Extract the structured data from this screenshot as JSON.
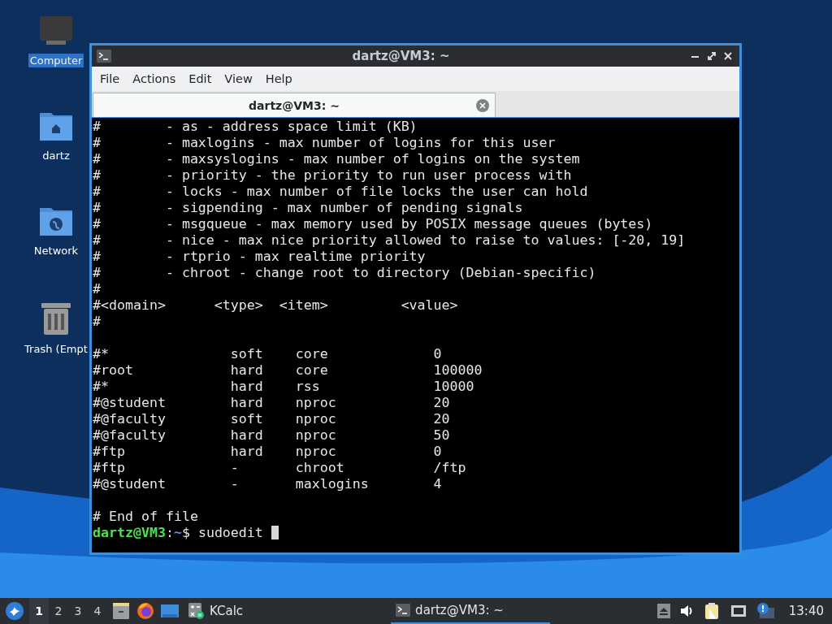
{
  "desktop_icons": [
    {
      "kind": "computer",
      "label": "Computer",
      "selected": true
    },
    {
      "kind": "home",
      "label": "dartz",
      "selected": false
    },
    {
      "kind": "network",
      "label": "Network",
      "selected": false
    },
    {
      "kind": "trash",
      "label": "Trash (Empt",
      "selected": false
    }
  ],
  "window": {
    "title": "dartz@VM3: ~",
    "menu": [
      "File",
      "Actions",
      "Edit",
      "View",
      "Help"
    ],
    "tabs": [
      {
        "label": "dartz@VM3: ~",
        "selected": true
      }
    ],
    "terminal": {
      "blocks": [
        [
          "#        - as - address space limit (KB)",
          "#        - maxlogins - max number of logins for this user",
          "#        - maxsyslogins - max number of logins on the system",
          "#        - priority - the priority to run user process with",
          "#        - locks - max number of file locks the user can hold",
          "#        - sigpending - max number of pending signals",
          "#        - msgqueue - max memory used by POSIX message queues (bytes)",
          "#        - nice - max nice priority allowed to raise to values: [-20, 19]",
          "#        - rtprio - max realtime priority",
          "#        - chroot - change root to directory (Debian-specific)",
          "#",
          "#<domain>      <type>  <item>         <value>",
          "#"
        ],
        [
          "#*               soft    core             0",
          "#root            hard    core             100000",
          "#*               hard    rss              10000",
          "#@student        hard    nproc            20",
          "#@faculty        soft    nproc            20",
          "#@faculty        hard    nproc            50",
          "#ftp             hard    nproc            0",
          "#ftp             -       chroot           /ftp",
          "#@student        -       maxlogins        4"
        ],
        [
          "# End of file"
        ]
      ],
      "prompt": {
        "user_host": "dartz@VM3",
        "separator": ":",
        "path": "~",
        "command": "$ sudoedit "
      }
    }
  },
  "taskbar": {
    "workspaces": [
      {
        "label": "1",
        "selected": true
      },
      {
        "label": "2",
        "selected": false
      },
      {
        "label": "3",
        "selected": false
      },
      {
        "label": "4",
        "selected": false
      }
    ],
    "tasks": [
      {
        "kind": "calculator",
        "label": "KCalc",
        "selected": false
      },
      {
        "kind": "terminal",
        "label": "dartz@VM3: ~",
        "selected": true
      }
    ],
    "clock": "13:40"
  }
}
